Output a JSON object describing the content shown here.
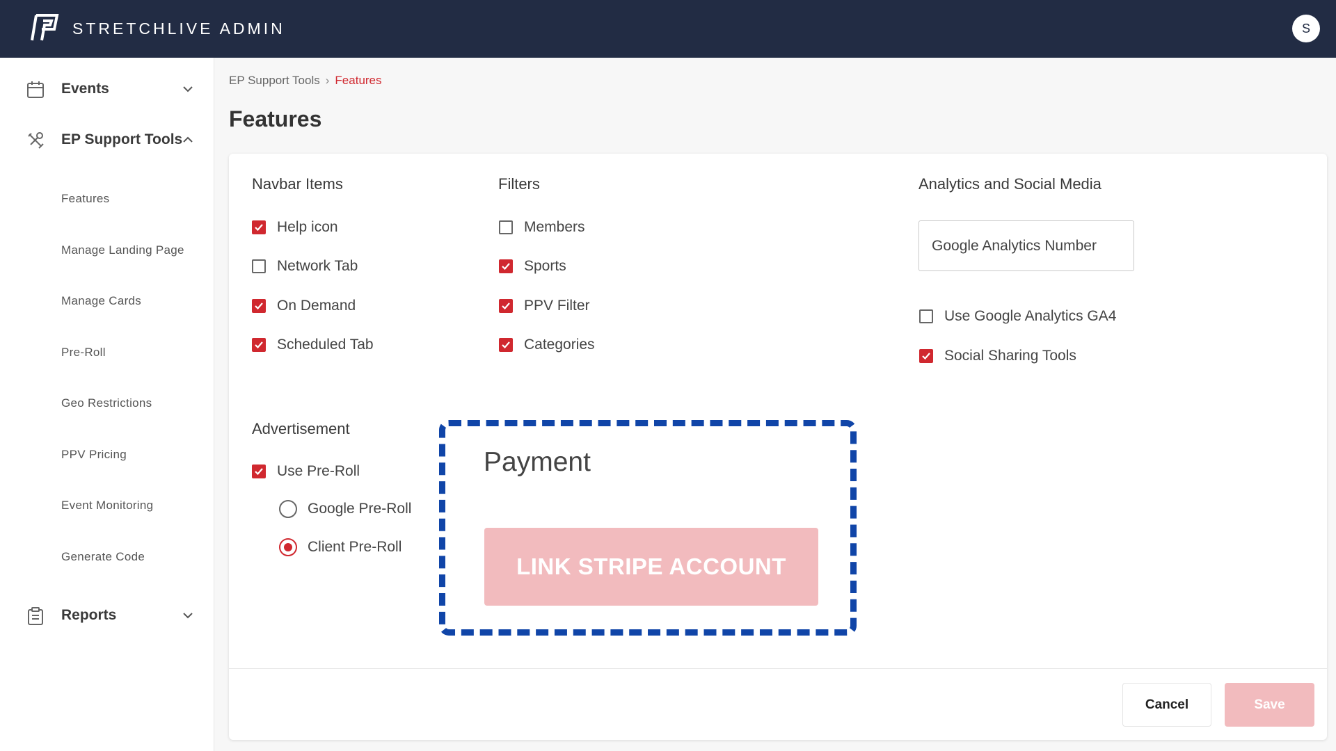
{
  "header": {
    "app_title": "STRETCHLIVE ADMIN",
    "avatar_initial": "S",
    "bg_color": "#222c44"
  },
  "sidebar": {
    "groups": [
      {
        "label": "Events",
        "icon": "calendar-icon",
        "expanded": false
      },
      {
        "label": "EP Support Tools",
        "icon": "tools-icon",
        "expanded": true
      },
      {
        "label": "Reports",
        "icon": "clipboard-icon",
        "expanded": false
      }
    ],
    "sub_items": [
      "Features",
      "Manage Landing Page",
      "Manage Cards",
      "Pre-Roll",
      "Geo Restrictions",
      "PPV Pricing",
      "Event Monitoring",
      "Generate Code"
    ]
  },
  "breadcrumb": {
    "parent": "EP Support Tools",
    "separator": "›",
    "current": "Features"
  },
  "page": {
    "title": "Features"
  },
  "navbar_items": {
    "title": "Navbar Items",
    "items": [
      {
        "label": "Help icon",
        "checked": true
      },
      {
        "label": "Network Tab",
        "checked": false
      },
      {
        "label": "On Demand",
        "checked": true
      },
      {
        "label": "Scheduled Tab",
        "checked": true
      }
    ]
  },
  "filters": {
    "title": "Filters",
    "items": [
      {
        "label": "Members",
        "checked": false
      },
      {
        "label": "Sports",
        "checked": true
      },
      {
        "label": "PPV Filter",
        "checked": true
      },
      {
        "label": "Categories",
        "checked": true
      }
    ]
  },
  "analytics": {
    "title": "Analytics and Social Media",
    "ga_placeholder": "Google Analytics Number",
    "items": [
      {
        "label": "Use Google Analytics GA4",
        "checked": false
      },
      {
        "label": "Social Sharing Tools",
        "checked": true
      }
    ]
  },
  "advertisement": {
    "title": "Advertisement",
    "use_preroll": {
      "label": "Use Pre-Roll",
      "checked": true
    },
    "options": [
      {
        "label": "Google Pre-Roll",
        "selected": false
      },
      {
        "label": "Client Pre-Roll",
        "selected": true
      }
    ]
  },
  "payment": {
    "title": "Payment",
    "button_label": "LINK STRIPE ACCOUNT"
  },
  "footer": {
    "cancel_label": "Cancel",
    "save_label": "Save"
  },
  "colors": {
    "accent": "#d0282f",
    "accent_disabled": "#f2bbbe",
    "highlight_border": "#1045a8"
  }
}
